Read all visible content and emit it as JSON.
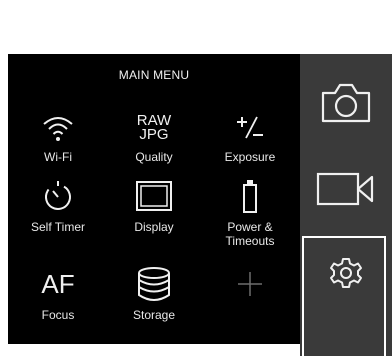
{
  "menu": {
    "title": "MAIN MENU",
    "items": [
      {
        "label": "Wi-Fi",
        "icon": "wifi-icon"
      },
      {
        "label": "Quality",
        "icon": "raw-jpg-icon",
        "icon_line1": "RAW",
        "icon_line2": "JPG"
      },
      {
        "label": "Exposure",
        "icon": "exposure-icon"
      },
      {
        "label": "Self Timer",
        "icon": "self-timer-icon"
      },
      {
        "label": "Display",
        "icon": "display-icon"
      },
      {
        "label": "Power &",
        "label2": "Timeouts",
        "icon": "battery-icon"
      },
      {
        "label": "Focus",
        "icon": "af-icon",
        "icon_text": "AF"
      },
      {
        "label": "Storage",
        "icon": "storage-icon"
      },
      {
        "label": "",
        "icon": "add-icon"
      }
    ]
  },
  "sidebar": {
    "buttons": [
      {
        "name": "photo-mode",
        "icon": "camera-icon"
      },
      {
        "name": "video-mode",
        "icon": "video-camera-icon"
      },
      {
        "name": "settings",
        "icon": "gear-icon",
        "selected": true
      }
    ]
  },
  "colors": {
    "screen_bg": "#000000",
    "sidebar_bg": "#3a3a3a",
    "foreground": "#f0f0f0",
    "selection": "#ffffff"
  }
}
